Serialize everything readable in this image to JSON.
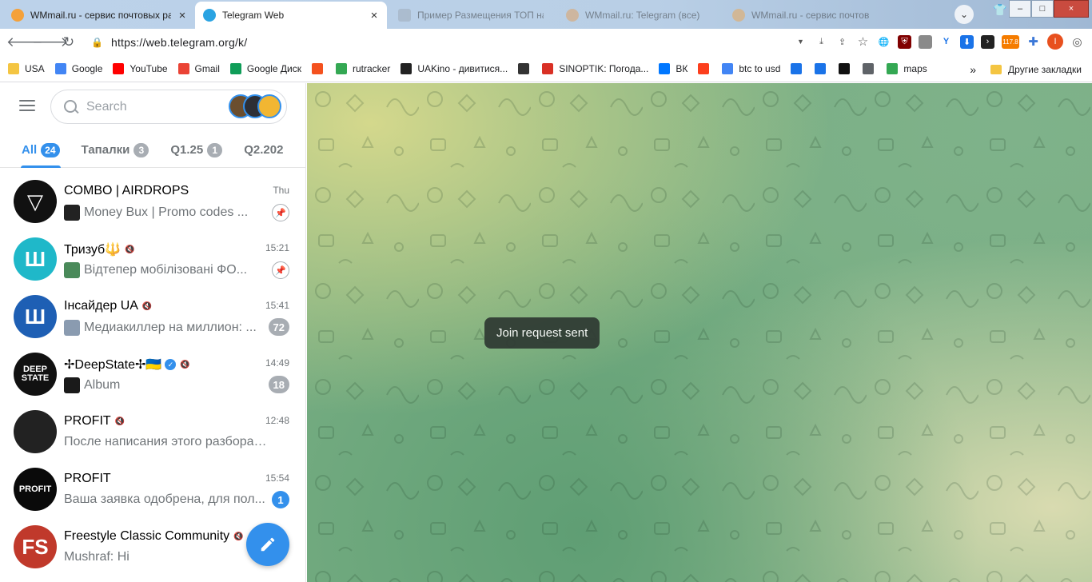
{
  "browser": {
    "tabs": [
      {
        "title": "WMmail.ru - сервис почтовых рас",
        "close": "×",
        "color": "#f4a13a"
      },
      {
        "title": "Telegram Web",
        "close": "×",
        "color": "#2aa3e2"
      },
      {
        "title": "Пример Размещения ТОП на сайт",
        "color": "#9aa5b1"
      },
      {
        "title": "WMmail.ru: Telegram (все)",
        "color": "#e79a4a"
      },
      {
        "title": "WMmail.ru - сервис почтовых",
        "color": "#f4a13a"
      }
    ],
    "window_controls": {
      "minimize": "–",
      "maximize": "□",
      "close": "×"
    },
    "url": "https://web.telegram.org/k/",
    "extension_badge": "117.8",
    "profile_initial": "I",
    "bookmarks": [
      {
        "label": "USA",
        "color": "#f4c542"
      },
      {
        "label": "Google",
        "color": "#4285f4"
      },
      {
        "label": "YouTube",
        "color": "#ff0000"
      },
      {
        "label": "Gmail",
        "color": "#ea4335"
      },
      {
        "label": "Google Диск",
        "color": "#0f9d58"
      },
      {
        "label": "",
        "color": "#f4511e"
      },
      {
        "label": "rutracker",
        "color": "#34a853"
      },
      {
        "label": "UAKino - дивитися...",
        "color": "#222222"
      },
      {
        "label": "",
        "color": "#333333"
      },
      {
        "label": "SINOPTIK: Погода...",
        "color": "#d93025"
      },
      {
        "label": "ВК",
        "color": "#0077ff"
      },
      {
        "label": "",
        "color": "#fc3f1d"
      },
      {
        "label": "btc to usd",
        "color": "#4285f4"
      },
      {
        "label": "",
        "color": "#1a73e8"
      },
      {
        "label": "",
        "color": "#1a73e8"
      },
      {
        "label": "",
        "color": "#111111"
      },
      {
        "label": "",
        "color": "#5f6368"
      },
      {
        "label": "maps",
        "color": "#34a853"
      }
    ],
    "bookmarks_more": "»",
    "other_bookmarks": "Другие закладки"
  },
  "telegram": {
    "search_placeholder": "Search",
    "folders": [
      {
        "label": "All",
        "count": "24",
        "active": true
      },
      {
        "label": "Тапалки",
        "count": "3"
      },
      {
        "label": "Q1.25",
        "count": "1"
      },
      {
        "label": "Q2.202",
        "count": ""
      }
    ],
    "chats": [
      {
        "title": "COMBO | AIRDROPS",
        "time": "Thu",
        "preview": "Money Bux | Promo codes ...",
        "pinned": true,
        "avatar_color": "#111111",
        "avatar_text": "▽",
        "muted": false
      },
      {
        "title": "Тризуб🔱",
        "time": "15:21",
        "preview": "Відтепер мобілізовані ФО...",
        "pinned": true,
        "avatar_color": "#1fb8c9",
        "avatar_text": "Ш",
        "muted": true
      },
      {
        "title": "Інсайдер UA",
        "time": "15:41",
        "preview": "Медиакиллер на миллион: ...",
        "count": "72",
        "avatar_color": "#1e5fb4",
        "avatar_text": "Ш",
        "muted": true
      },
      {
        "title": "✢DeepState✢🇺🇦",
        "time": "14:49",
        "preview": "Album",
        "count": "18",
        "avatar_color": "#111111",
        "avatar_text": "DEEP STATE",
        "muted": true,
        "verified": true
      },
      {
        "title": "PROFIT",
        "time": "12:48",
        "preview": "После написания этого разбора по...",
        "avatar_color": "#222222",
        "avatar_text": "",
        "muted": true
      },
      {
        "title": "PROFIT",
        "time": "15:54",
        "preview": "Ваша заявка одобрена, для пол...",
        "count": "1",
        "count_blue": true,
        "avatar_color": "#0a0a0a",
        "avatar_text": "PROFIT",
        "muted": false
      },
      {
        "title": "Freestyle Classic Community",
        "time": "",
        "preview": "Mushraf: Hi",
        "avatar_color": "#c0392b",
        "avatar_text": "FS",
        "muted": true
      }
    ],
    "toast": "Join request sent"
  }
}
